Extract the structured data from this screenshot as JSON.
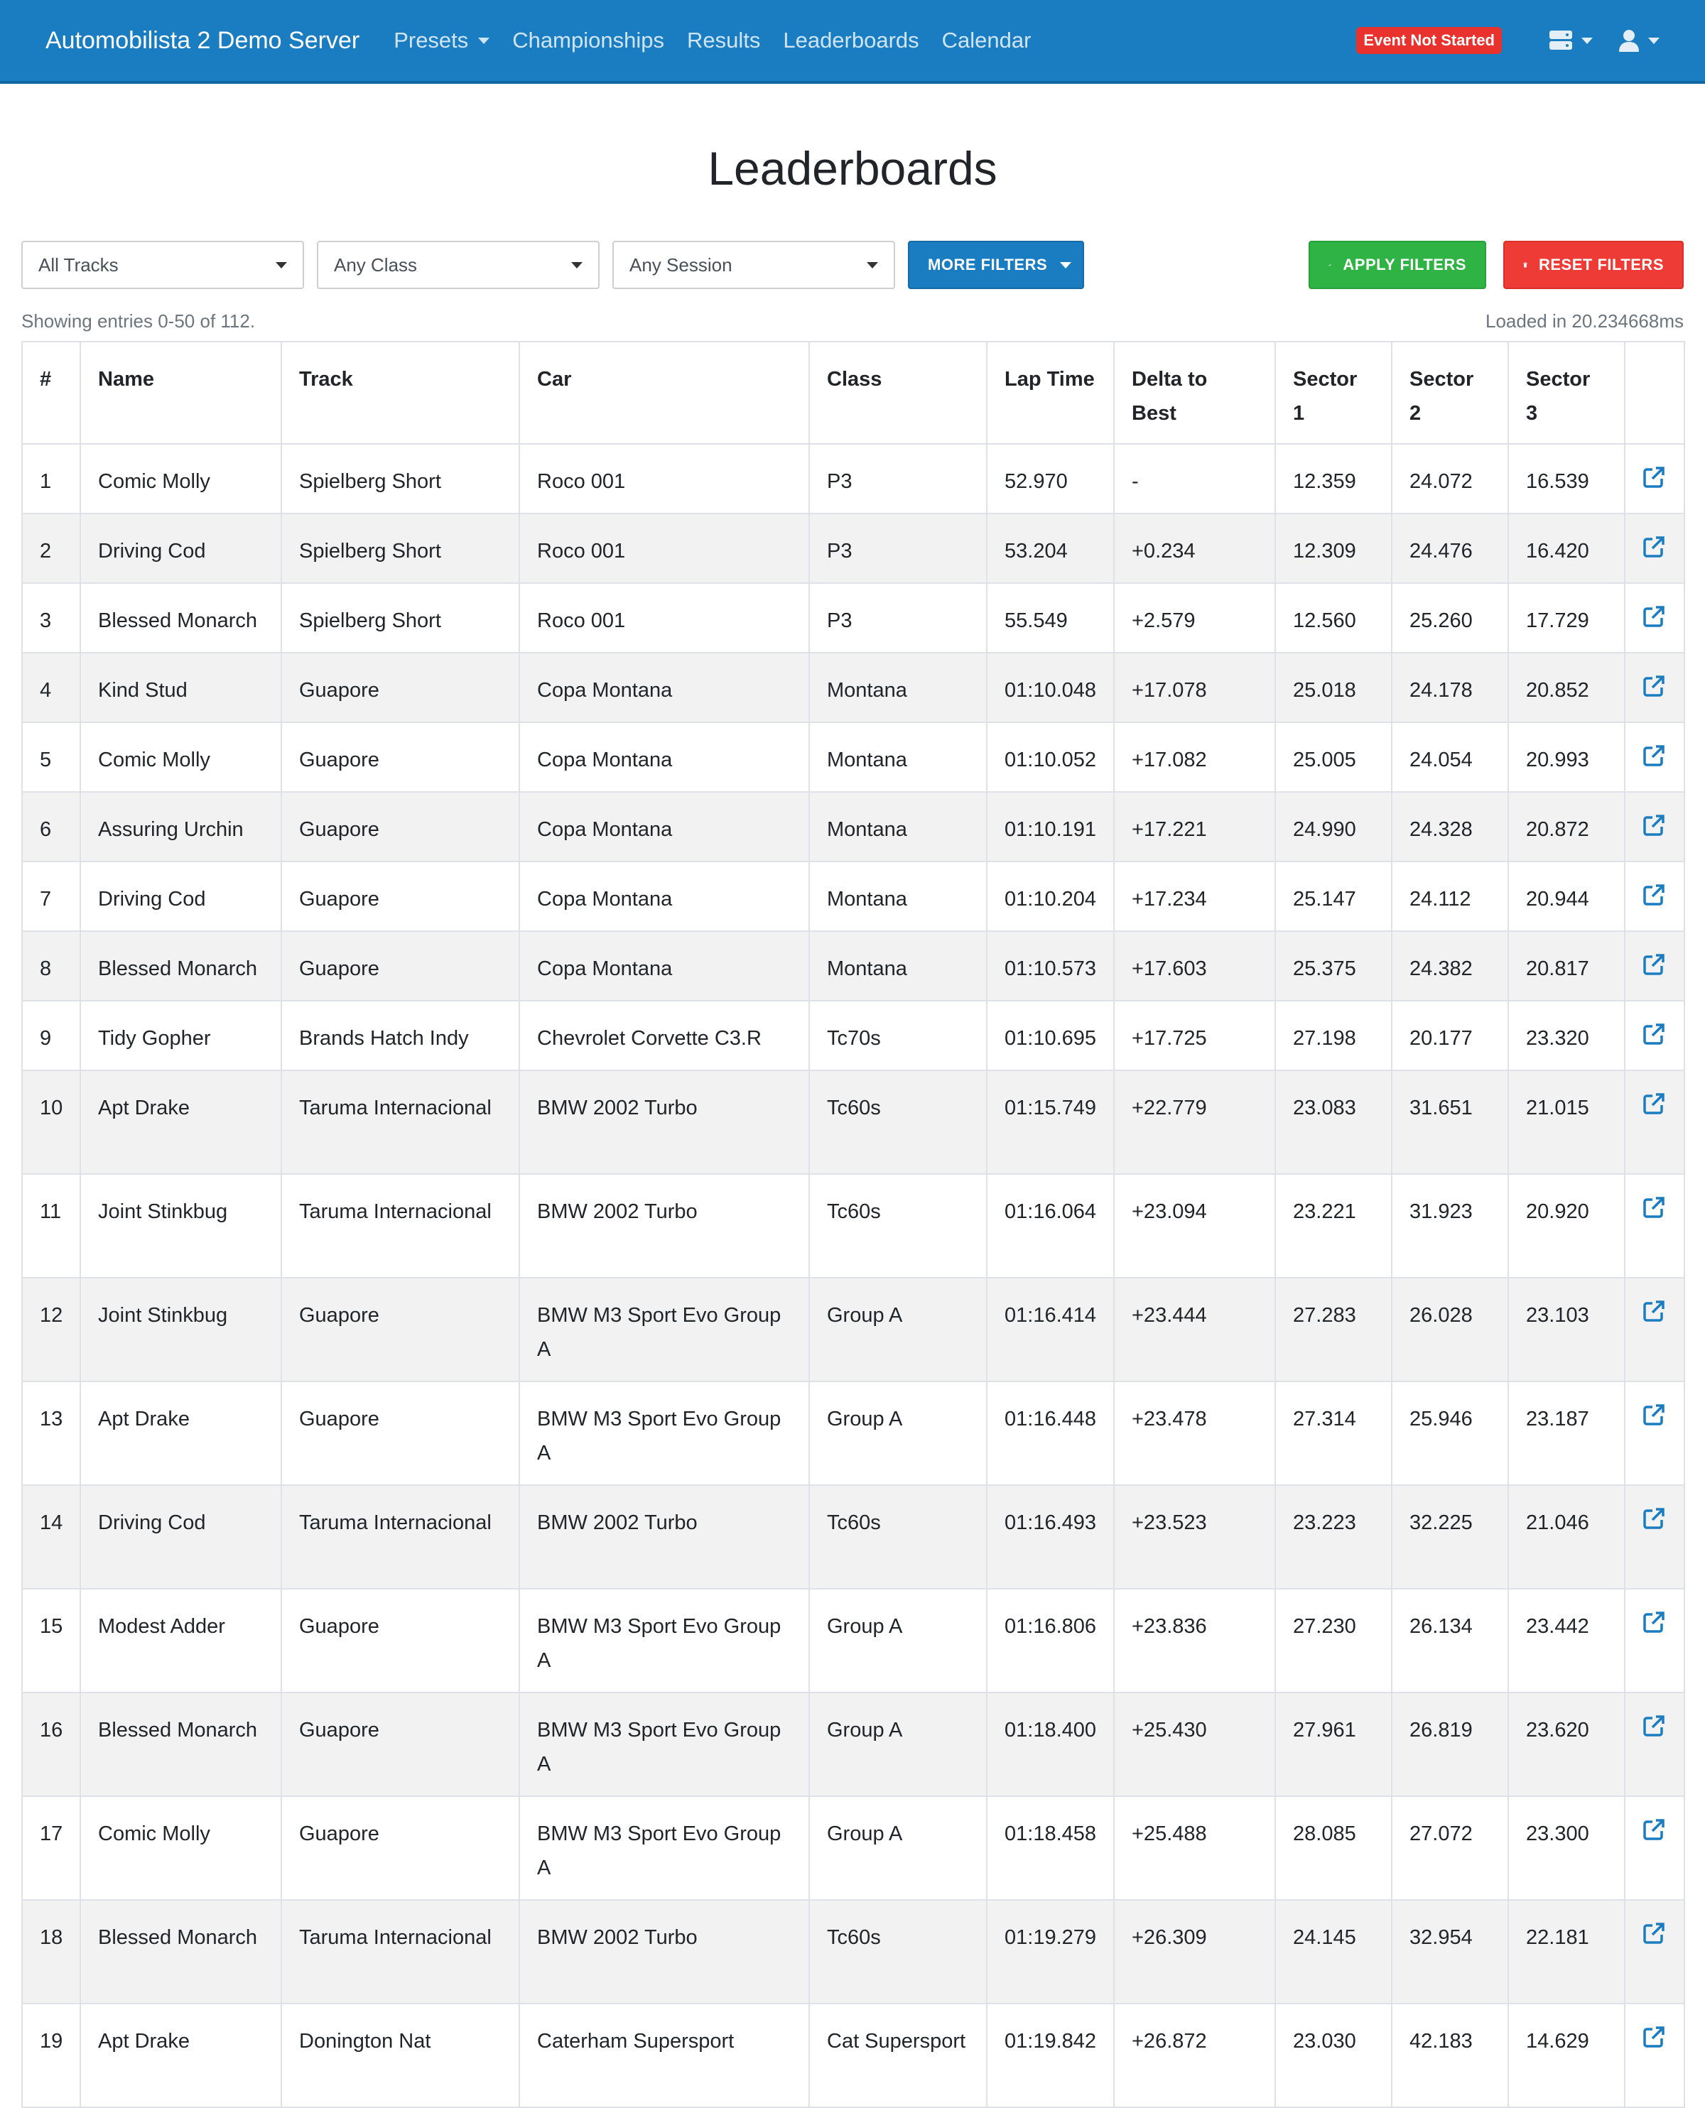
{
  "navbar": {
    "brand": "Automobilista 2 Demo Server",
    "links": [
      "Presets",
      "Championships",
      "Results",
      "Leaderboards",
      "Calendar"
    ],
    "status_badge": "Event Not Started",
    "icons": [
      "server-icon",
      "user-icon"
    ],
    "colors": {
      "background": "#1a7cc1",
      "badge": "#e9322d"
    }
  },
  "page": {
    "title": "Leaderboards"
  },
  "filters": {
    "track": "All Tracks",
    "class": "Any Class",
    "session": "Any Session",
    "more_label": "MORE FILTERS",
    "apply_label": "APPLY FILTERS",
    "reset_label": "RESET FILTERS"
  },
  "info": {
    "showing": "Showing entries 0-50 of 112.",
    "loaded": "Loaded in 20.234668ms"
  },
  "table": {
    "headers": [
      "#",
      "Name",
      "Track",
      "Car",
      "Class",
      "Lap Time",
      "Delta to Best",
      "Sector 1",
      "Sector 2",
      "Sector 3"
    ],
    "rows": [
      {
        "pos": "1",
        "name": "Comic Molly",
        "track": "Spielberg Short",
        "car": "Roco 001",
        "class": "P3",
        "lap": "52.970",
        "delta": "-",
        "s1": "12.359",
        "s2": "24.072",
        "s3": "16.539"
      },
      {
        "pos": "2",
        "name": "Driving Cod",
        "track": "Spielberg Short",
        "car": "Roco 001",
        "class": "P3",
        "lap": "53.204",
        "delta": "+0.234",
        "s1": "12.309",
        "s2": "24.476",
        "s3": "16.420"
      },
      {
        "pos": "3",
        "name": "Blessed Monarch",
        "track": "Spielberg Short",
        "car": "Roco 001",
        "class": "P3",
        "lap": "55.549",
        "delta": "+2.579",
        "s1": "12.560",
        "s2": "25.260",
        "s3": "17.729"
      },
      {
        "pos": "4",
        "name": "Kind Stud",
        "track": "Guapore",
        "car": "Copa Montana",
        "class": "Montana",
        "lap": "01:10.048",
        "delta": "+17.078",
        "s1": "25.018",
        "s2": "24.178",
        "s3": "20.852"
      },
      {
        "pos": "5",
        "name": "Comic Molly",
        "track": "Guapore",
        "car": "Copa Montana",
        "class": "Montana",
        "lap": "01:10.052",
        "delta": "+17.082",
        "s1": "25.005",
        "s2": "24.054",
        "s3": "20.993"
      },
      {
        "pos": "6",
        "name": "Assuring Urchin",
        "track": "Guapore",
        "car": "Copa Montana",
        "class": "Montana",
        "lap": "01:10.191",
        "delta": "+17.221",
        "s1": "24.990",
        "s2": "24.328",
        "s3": "20.872"
      },
      {
        "pos": "7",
        "name": "Driving Cod",
        "track": "Guapore",
        "car": "Copa Montana",
        "class": "Montana",
        "lap": "01:10.204",
        "delta": "+17.234",
        "s1": "25.147",
        "s2": "24.112",
        "s3": "20.944"
      },
      {
        "pos": "8",
        "name": "Blessed Monarch",
        "track": "Guapore",
        "car": "Copa Montana",
        "class": "Montana",
        "lap": "01:10.573",
        "delta": "+17.603",
        "s1": "25.375",
        "s2": "24.382",
        "s3": "20.817"
      },
      {
        "pos": "9",
        "name": "Tidy Gopher",
        "track": "Brands Hatch Indy",
        "car": "Chevrolet Corvette C3.R",
        "class": "Tc70s",
        "lap": "01:10.695",
        "delta": "+17.725",
        "s1": "27.198",
        "s2": "20.177",
        "s3": "23.320"
      },
      {
        "pos": "10",
        "name": "Apt Drake",
        "track": "Taruma Internacional",
        "car": "BMW 2002 Turbo",
        "class": "Tc60s",
        "lap": "01:15.749",
        "delta": "+22.779",
        "s1": "23.083",
        "s2": "31.651",
        "s3": "21.015"
      },
      {
        "pos": "11",
        "name": "Joint Stinkbug",
        "track": "Taruma Internacional",
        "car": "BMW 2002 Turbo",
        "class": "Tc60s",
        "lap": "01:16.064",
        "delta": "+23.094",
        "s1": "23.221",
        "s2": "31.923",
        "s3": "20.920"
      },
      {
        "pos": "12",
        "name": "Joint Stinkbug",
        "track": "Guapore",
        "car": "BMW M3 Sport Evo Group A",
        "class": "Group A",
        "lap": "01:16.414",
        "delta": "+23.444",
        "s1": "27.283",
        "s2": "26.028",
        "s3": "23.103"
      },
      {
        "pos": "13",
        "name": "Apt Drake",
        "track": "Guapore",
        "car": "BMW M3 Sport Evo Group A",
        "class": "Group A",
        "lap": "01:16.448",
        "delta": "+23.478",
        "s1": "27.314",
        "s2": "25.946",
        "s3": "23.187"
      },
      {
        "pos": "14",
        "name": "Driving Cod",
        "track": "Taruma Internacional",
        "car": "BMW 2002 Turbo",
        "class": "Tc60s",
        "lap": "01:16.493",
        "delta": "+23.523",
        "s1": "23.223",
        "s2": "32.225",
        "s3": "21.046"
      },
      {
        "pos": "15",
        "name": "Modest Adder",
        "track": "Guapore",
        "car": "BMW M3 Sport Evo Group A",
        "class": "Group A",
        "lap": "01:16.806",
        "delta": "+23.836",
        "s1": "27.230",
        "s2": "26.134",
        "s3": "23.442"
      },
      {
        "pos": "16",
        "name": "Blessed Monarch",
        "track": "Guapore",
        "car": "BMW M3 Sport Evo Group A",
        "class": "Group A",
        "lap": "01:18.400",
        "delta": "+25.430",
        "s1": "27.961",
        "s2": "26.819",
        "s3": "23.620"
      },
      {
        "pos": "17",
        "name": "Comic Molly",
        "track": "Guapore",
        "car": "BMW M3 Sport Evo Group A",
        "class": "Group A",
        "lap": "01:18.458",
        "delta": "+25.488",
        "s1": "28.085",
        "s2": "27.072",
        "s3": "23.300"
      },
      {
        "pos": "18",
        "name": "Blessed Monarch",
        "track": "Taruma Internacional",
        "car": "BMW 2002 Turbo",
        "class": "Tc60s",
        "lap": "01:19.279",
        "delta": "+26.309",
        "s1": "24.145",
        "s2": "32.954",
        "s3": "22.181"
      },
      {
        "pos": "19",
        "name": "Apt Drake",
        "track": "Donington Nat",
        "car": "Caterham Supersport",
        "class": "Cat Supersport",
        "lap": "01:19.842",
        "delta": "+26.872",
        "s1": "23.030",
        "s2": "42.183",
        "s3": "14.629"
      }
    ]
  }
}
